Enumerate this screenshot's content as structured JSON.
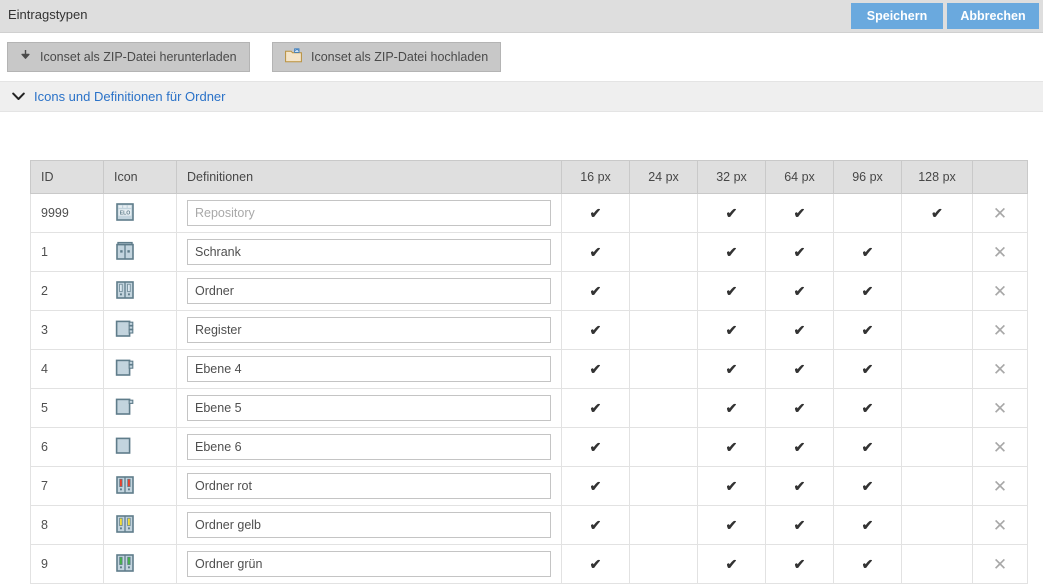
{
  "topbar": {
    "title": "Eintragstypen",
    "save_label": "Speichern",
    "cancel_label": "Abbrechen",
    "button_color": "#6aa9de"
  },
  "toolbar": {
    "download_label": "Iconset als ZIP-Datei herunterladen",
    "download_icon": "download-arrow-icon",
    "upload_label": "Iconset als ZIP-Datei hochladen",
    "upload_icon": "folder-upload-icon",
    "info_icon": "info-circle-icon"
  },
  "section": {
    "expanded": true,
    "chevron_icon": "chevron-down-icon",
    "title": "Icons und Definitionen für Ordner",
    "title_color": "#2a72c8"
  },
  "table": {
    "columns": [
      {
        "key": "id",
        "label": "ID"
      },
      {
        "key": "icon",
        "label": "Icon"
      },
      {
        "key": "def",
        "label": "Definitionen"
      },
      {
        "key": "px16",
        "label": "16 px"
      },
      {
        "key": "px24",
        "label": "24 px"
      },
      {
        "key": "px32",
        "label": "32 px"
      },
      {
        "key": "px64",
        "label": "64 px"
      },
      {
        "key": "px96",
        "label": "96 px"
      },
      {
        "key": "px128",
        "label": "128 px"
      },
      {
        "key": "del",
        "label": ""
      }
    ],
    "check_glyph": "✔",
    "delete_glyph": "✕",
    "rows": [
      {
        "id": "9999",
        "icon": "elo-repository-icon",
        "definition": "",
        "placeholder": "Repository",
        "sizes": {
          "px16": true,
          "px24": false,
          "px32": true,
          "px64": true,
          "px96": false,
          "px128": true
        }
      },
      {
        "id": "1",
        "icon": "cabinet-icon",
        "definition": "Schrank",
        "placeholder": "",
        "sizes": {
          "px16": true,
          "px24": false,
          "px32": true,
          "px64": true,
          "px96": true,
          "px128": false
        }
      },
      {
        "id": "2",
        "icon": "binder-blue-icon",
        "definition": "Ordner",
        "placeholder": "",
        "sizes": {
          "px16": true,
          "px24": false,
          "px32": true,
          "px64": true,
          "px96": true,
          "px128": false
        }
      },
      {
        "id": "3",
        "icon": "register-3tab-icon",
        "definition": "Register",
        "placeholder": "",
        "sizes": {
          "px16": true,
          "px24": false,
          "px32": true,
          "px64": true,
          "px96": true,
          "px128": false
        }
      },
      {
        "id": "4",
        "icon": "register-2tab-icon",
        "definition": "Ebene 4",
        "placeholder": "",
        "sizes": {
          "px16": true,
          "px24": false,
          "px32": true,
          "px64": true,
          "px96": true,
          "px128": false
        }
      },
      {
        "id": "5",
        "icon": "register-1tab-icon",
        "definition": "Ebene 5",
        "placeholder": "",
        "sizes": {
          "px16": true,
          "px24": false,
          "px32": true,
          "px64": true,
          "px96": true,
          "px128": false
        }
      },
      {
        "id": "6",
        "icon": "register-0tab-icon",
        "definition": "Ebene 6",
        "placeholder": "",
        "sizes": {
          "px16": true,
          "px24": false,
          "px32": true,
          "px64": true,
          "px96": true,
          "px128": false
        }
      },
      {
        "id": "7",
        "icon": "binder-red-icon",
        "definition": "Ordner rot",
        "placeholder": "",
        "sizes": {
          "px16": true,
          "px24": false,
          "px32": true,
          "px64": true,
          "px96": true,
          "px128": false
        }
      },
      {
        "id": "8",
        "icon": "binder-yellow-icon",
        "definition": "Ordner gelb",
        "placeholder": "",
        "sizes": {
          "px16": true,
          "px24": false,
          "px32": true,
          "px64": true,
          "px96": true,
          "px128": false
        }
      },
      {
        "id": "9",
        "icon": "binder-green-icon",
        "definition": "Ordner grün",
        "placeholder": "",
        "sizes": {
          "px16": true,
          "px24": false,
          "px32": true,
          "px64": true,
          "px96": true,
          "px128": false
        }
      }
    ]
  }
}
